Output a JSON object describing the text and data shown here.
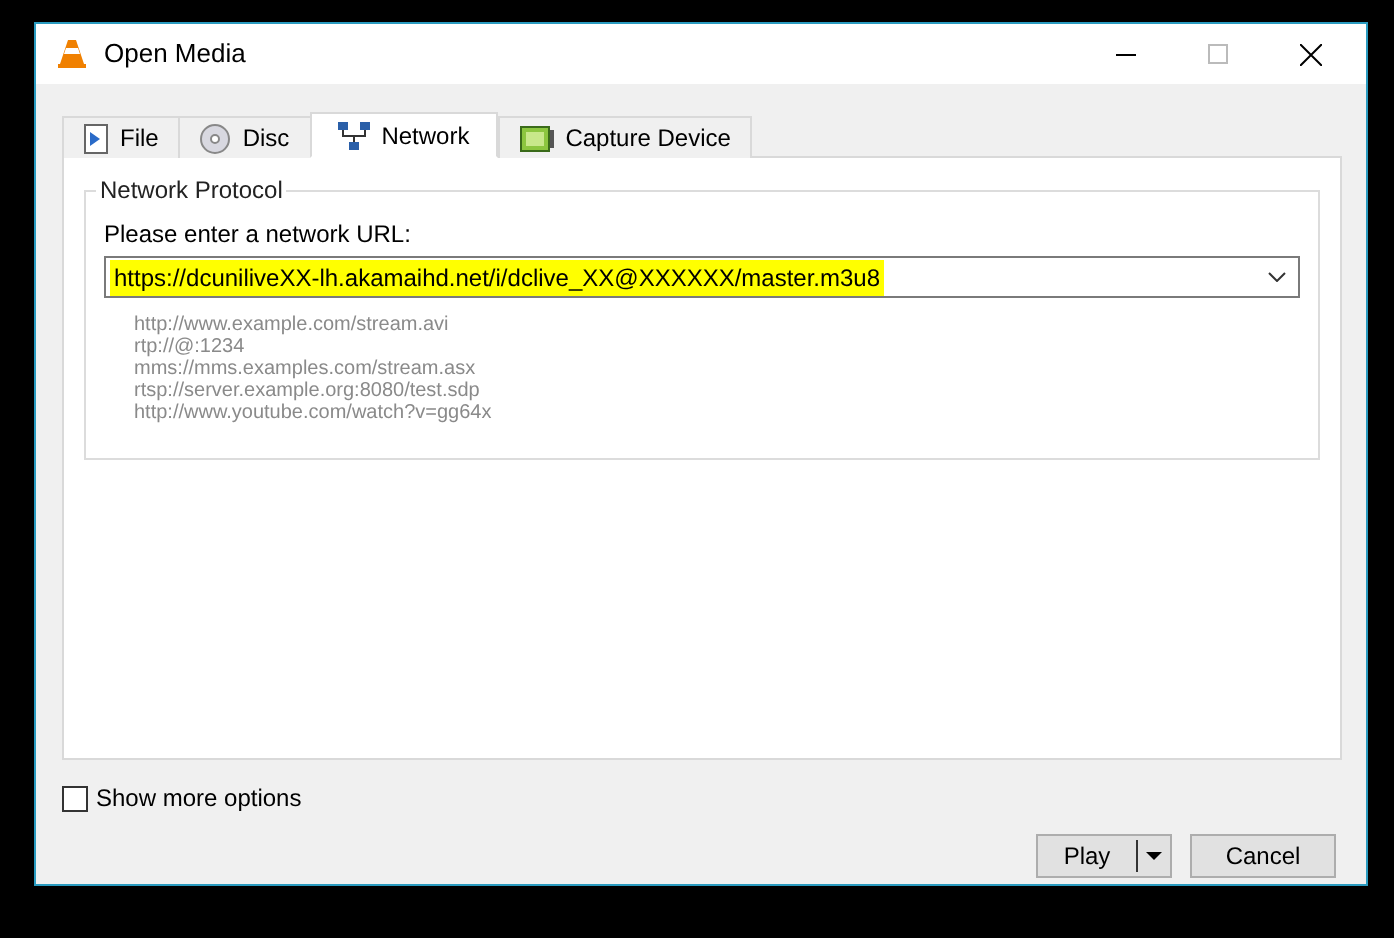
{
  "window": {
    "title": "Open Media"
  },
  "tabs": [
    {
      "label": "File",
      "kind": "file",
      "selected": false
    },
    {
      "label": "Disc",
      "kind": "disc",
      "selected": false
    },
    {
      "label": "Network",
      "kind": "network",
      "selected": true
    },
    {
      "label": "Capture Device",
      "kind": "capture",
      "selected": false
    }
  ],
  "network_protocol": {
    "title": "Network Protocol",
    "url_label": "Please enter a network URL:",
    "url_value": "https://dcuniliveXX-lh.akamaihd.net/i/dclive_XX@XXXXXX/master.m3u8",
    "highlighted": true,
    "examples": [
      "http://www.example.com/stream.avi",
      "rtp://@:1234",
      "mms://mms.examples.com/stream.asx",
      "rtsp://server.example.org:8080/test.sdp",
      "http://www.youtube.com/watch?v=gg64x"
    ]
  },
  "show_more_options": {
    "label": "Show more options",
    "checked": false
  },
  "buttons": [
    {
      "label": "Play",
      "kind": "split"
    },
    {
      "label": "Cancel",
      "kind": "plain"
    }
  ]
}
